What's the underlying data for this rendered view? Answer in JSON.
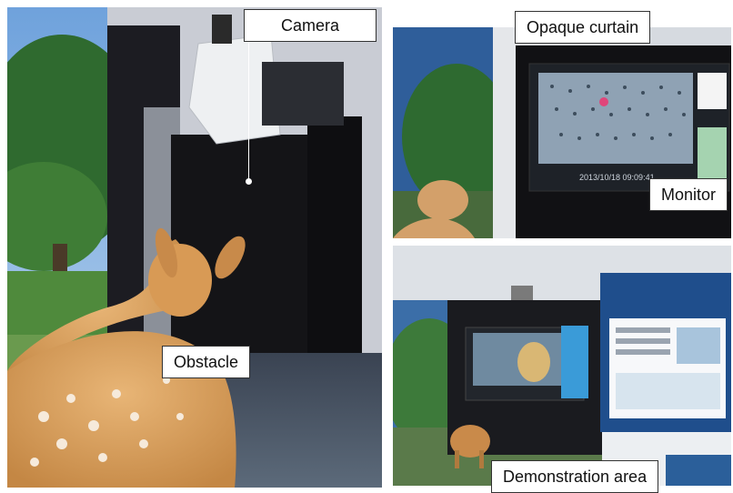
{
  "labels": {
    "camera": "Camera",
    "obstacle": "Obstacle",
    "opaque_curtain": "Opaque curtain",
    "monitor": "Monitor",
    "demonstration_area": "Demonstration area"
  },
  "screens": {
    "top_right_timestamp": "2013/10/18 09:09:41"
  },
  "colors": {
    "sky": "#5a8fd0",
    "foliage": "#3f7a3a",
    "curtain": "#1a1a1c",
    "deer": "#d9a264",
    "label_bg": "#ffffff"
  }
}
